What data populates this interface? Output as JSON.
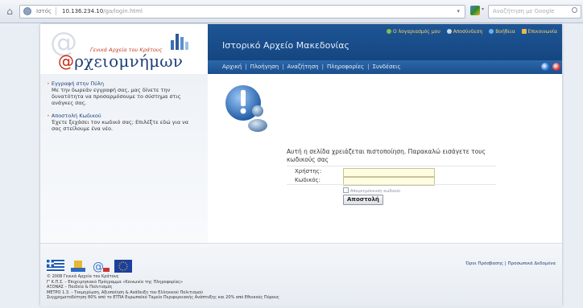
{
  "browser": {
    "url_proto": "Ιστός",
    "url_host": "10.136.234.10",
    "url_path": "/ga/login.html",
    "search_placeholder": "Αναζήτηση με Google"
  },
  "header": {
    "logo_subtitle": "Γενικά Αρχεία του Κράτους",
    "logo_title": "ρχειομνήμων",
    "site_title": "Ιστορικό Αρχείο Μακεδονίας",
    "top_links": [
      "Ο λογαριασμός μου",
      "Αποσύνδεση",
      "Βοήθεια",
      "Επικοινωνία"
    ],
    "nav": [
      "Αρχική",
      "Πλοήγηση",
      "Αναζήτηση",
      "Πληροφορίες",
      "Συνδέσεις"
    ]
  },
  "left_panel": {
    "items": [
      {
        "title": "Εγγραφή στην Πύλη",
        "desc": "Με την δωρεάν εγγραφή σας, μας δίνετε την δυνατότητα να προσαρμόσουμε το σύστημα στις ανάγκες σας."
      },
      {
        "title": "Αποστολή Κωδικού",
        "desc": "Έχετε ξεχάσει τον κωδικό σας; Επιλέξτε εδώ για να σας στείλουμε ένα νέο."
      }
    ]
  },
  "login": {
    "message": "Αυτή η σελίδα χρειάζεται πιστοποίηση. Παρακαλώ εισάγετε τους κωδικούς σας",
    "username_label": "Χρήστης:",
    "password_label": "Κωδικός:",
    "remember_label": "Απομνημόνευση κωδικού",
    "submit_label": "Αποστολή"
  },
  "footer": {
    "lines": [
      "© 2008 Γενικά Αρχεία του Κράτους",
      "Γ' Κ.Π.Σ. – Επιχειρησιακό Πρόγραμμα «Κοινωνία της Πληροφορίας»",
      "ΑΞΟΝΑΣ – Παιδεία & Πολιτισμός",
      "ΜΕΤΡΟ 1.3. – Τεκμηρίωση, Αξιοποίηση & Ανάδειξη του Ελληνικού Πολιτισμού",
      "Συγχρηματοδότηση 80% από το ΕΤΠΑ Ευρωπαϊκό Ταμείο Περιφερειακής Ανάπτυξης και 20% από Εθνικούς Πόρους"
    ],
    "links": "Όροι Πρόσβασης | Προσωπικά Δεδομένα"
  }
}
